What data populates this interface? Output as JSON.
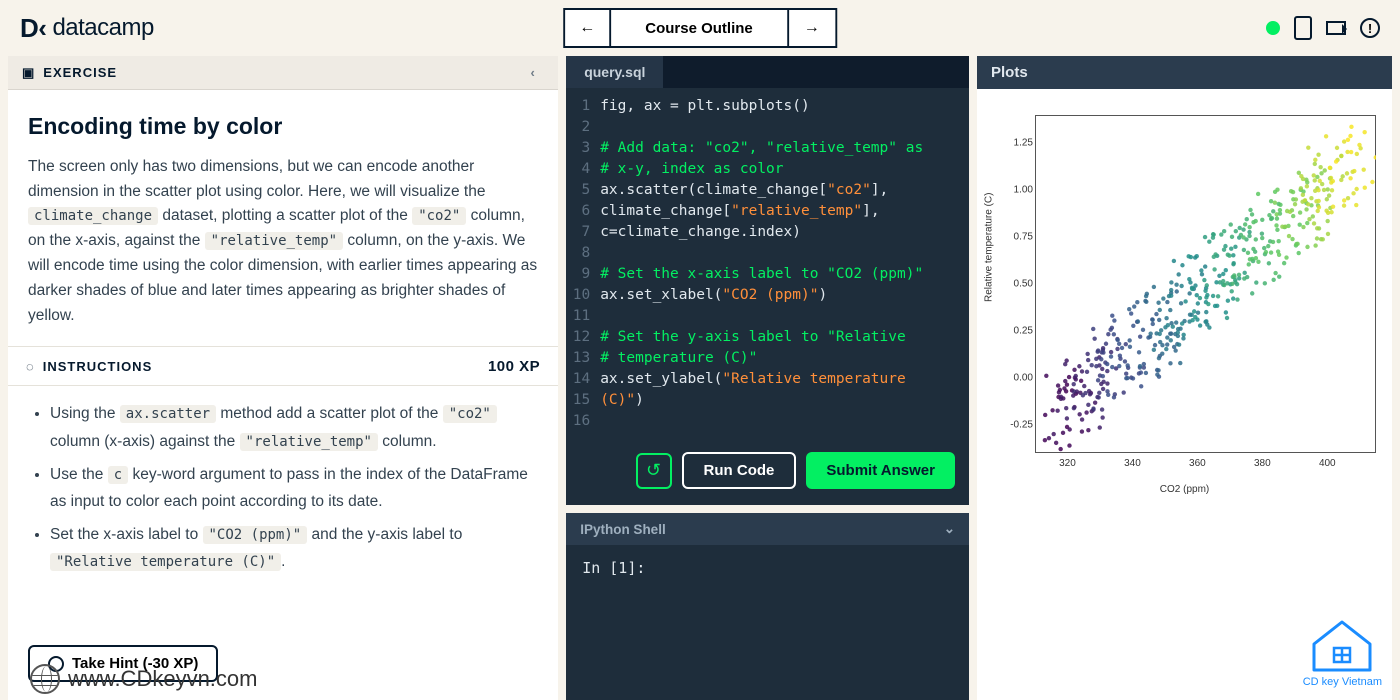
{
  "brand": {
    "name": "datacamp",
    "logo_mark": "D‹"
  },
  "topnav": {
    "prev": "←",
    "title": "Course Outline",
    "next": "→"
  },
  "status": {
    "online": true
  },
  "left_panel": {
    "section_label": "EXERCISE",
    "title": "Encoding time by color",
    "xp_label": "100 XP",
    "instructions_label": "INSTRUCTIONS",
    "hint_button": "Take Hint (-30 XP)"
  },
  "editor": {
    "filename": "query.sql",
    "run_label": "Run Code",
    "submit_label": "Submit Answer",
    "reset_icon": "↺"
  },
  "code_lines": [
    {
      "n": 1,
      "plain": "fig, ax = plt.subplots()"
    },
    {
      "n": 2,
      "plain": ""
    },
    {
      "n": 3,
      "comment": "# Add data: \"co2\", \"relative_temp\" as"
    },
    {
      "n": 4,
      "comment": "# x-y, index as color"
    },
    {
      "n": 5,
      "pre": "ax.scatter(climate_change[",
      "str": "\"co2\"",
      "post": "],"
    },
    {
      "n": 6,
      "pre": "climate_change[",
      "str": "\"relative_temp\"",
      "post": "],"
    },
    {
      "n": 7,
      "plain": "c=climate_change.index)"
    },
    {
      "n": 8,
      "plain": ""
    },
    {
      "n": 9,
      "comment": "# Set the x-axis label to \"CO2 (ppm)\""
    },
    {
      "n": 10,
      "pre": "ax.set_xlabel(",
      "str": "\"CO2 (ppm)\"",
      "post": ")"
    },
    {
      "n": 11,
      "plain": ""
    },
    {
      "n": 12,
      "comment": "# Set the y-axis label to \"Relative"
    },
    {
      "n": 13,
      "comment": "# temperature (C)\""
    },
    {
      "n": 14,
      "pre": "ax.set_ylabel(",
      "str": "\"Relative temperature"
    },
    {
      "n": 15,
      "str": "(C)\"",
      "post": ")"
    },
    {
      "n": 16,
      "plain": ""
    }
  ],
  "shell": {
    "title": "IPython Shell",
    "prompt": "In [1]:"
  },
  "plots": {
    "title": "Plots"
  },
  "chart_data": {
    "type": "scatter",
    "xlabel": "CO2 (ppm)",
    "ylabel": "Relative temperature (C)",
    "xlim": [
      310,
      415
    ],
    "ylim": [
      -0.4,
      1.4
    ],
    "xticks": [
      320,
      340,
      360,
      380,
      400
    ],
    "yticks": [
      -0.25,
      0.0,
      0.25,
      0.5,
      0.75,
      1.0,
      1.25
    ],
    "colormap": "viridis",
    "n_points": 500,
    "note": "CO2 vs relative temperature, color encodes time index (dark purple = early, yellow = late)"
  },
  "watermark": {
    "url": "www.CDkeyvn.com",
    "brand": "CD key Vietnam"
  }
}
